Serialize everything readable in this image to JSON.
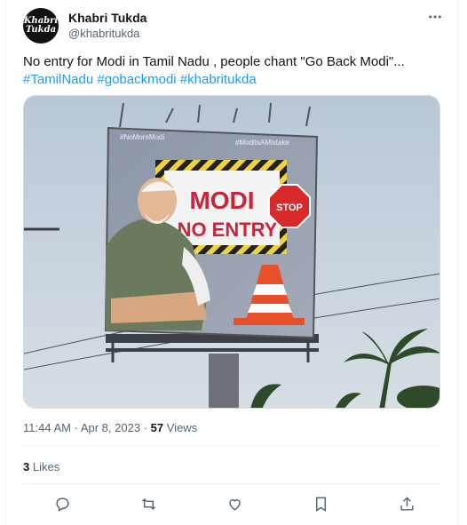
{
  "author": {
    "display_name": "Khabri Tukda",
    "handle": "@khabritukda",
    "avatar_text_1": "Khabri",
    "avatar_text_2": "Tukda"
  },
  "tweet": {
    "text": "No entry for Modi in Tamil Nadu , people chant \"Go Back Modi\"...",
    "hashtags": [
      "#TamilNadu",
      "#gobackmodi",
      "#khabritukda"
    ]
  },
  "media": {
    "billboard_hashtag_left": "#NoMoreModi",
    "billboard_hashtag_right": "#ModiIsAMistake",
    "sign_line_1": "MODI",
    "sign_line_2": "NO ENTRY",
    "stop_label": "STOP"
  },
  "meta": {
    "time": "11:44 AM",
    "separator": "·",
    "date": "Apr 8, 2023",
    "views_count": "57",
    "views_label": "Views"
  },
  "likes": {
    "count": "3",
    "label": "Likes"
  },
  "icons": {
    "more": "more-icon",
    "reply": "reply-icon",
    "retweet": "retweet-icon",
    "like": "like-icon",
    "bookmark": "bookmark-icon",
    "share": "share-icon"
  },
  "colors": {
    "link": "#1d9bf0",
    "secondary_text": "#536471",
    "primary_text": "#0f1419"
  }
}
